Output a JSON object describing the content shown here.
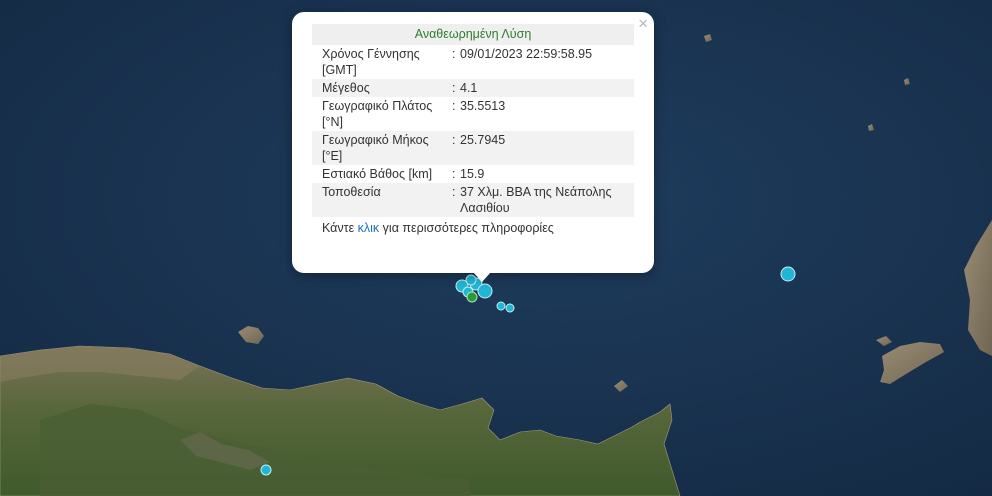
{
  "popup": {
    "title": "Αναθεωρημένη Λύση",
    "close_glyph": "×",
    "rows": [
      {
        "label": "Χρόνος Γέννησης [GMT]",
        "value": "09/01/2023 22:59:58.95"
      },
      {
        "label": "Μέγεθος",
        "value": "4.1"
      },
      {
        "label": "Γεωγραφικό Πλάτος [°N]",
        "value": "35.5513"
      },
      {
        "label": "Γεωγραφικό Μήκος [°E]",
        "value": "25.7945"
      },
      {
        "label": "Εστιακό Βάθος [km]",
        "value": "15.9"
      },
      {
        "label": "Τοποθεσία",
        "value": "37 Χλμ. ΒΒΑ της Νεάπολης Λασιθίου"
      }
    ],
    "row_separator": ":",
    "more_prefix": "Κάντε",
    "more_link": "κλικ",
    "more_suffix": "για περισσότερες πληροφορίες"
  },
  "colors": {
    "sea": "#1a3350",
    "land": "#5a6a3a",
    "quake_marker": "#22b6d4",
    "selected_marker": "#2a9a3a"
  }
}
